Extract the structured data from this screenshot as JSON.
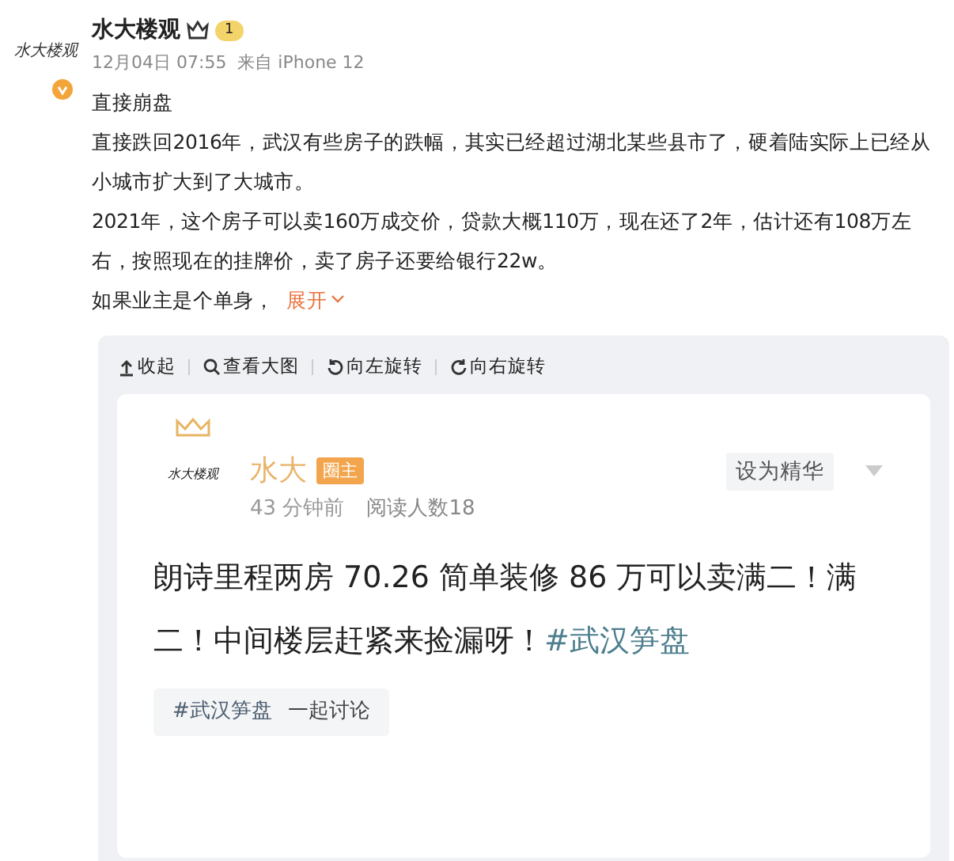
{
  "post": {
    "avatar_text": "水大楼观",
    "verified": true,
    "author": "水大楼观",
    "level": "1",
    "meta": "12月04日 07:55  来自 iPhone 12",
    "title": "直接崩盘",
    "paragraphs": [
      "直接跌回2016年，武汉有些房子的跌幅，其实已经超过湖北某些县市了，硬着陆实际上已经从小城市扩大到了大城市。",
      "2021年，这个房子可以卖160万成交价，贷款大概110万，现在还了2年，估计还有108万左右，按照现在的挂牌价，卖了房子还要给银行22w。"
    ],
    "last_line": "如果业主是个单身，",
    "expand": "展开"
  },
  "image_toolbar": [
    {
      "kind": "collapse",
      "label": "收起"
    },
    {
      "kind": "zoom",
      "label": "查看大图"
    },
    {
      "kind": "rotate_left",
      "label": "向左旋转"
    },
    {
      "kind": "rotate_right",
      "label": "向右旋转"
    }
  ],
  "card": {
    "avatar_text": "水大楼观",
    "name": "水大",
    "role": "圈主",
    "time": "43 分钟前",
    "reads": "阅读人数18",
    "action": "设为精华",
    "text": "朗诗里程两房 70.26 简单装修 86 万可以卖满二！满二！中间楼层赶紧来捡漏呀！",
    "hashtag": "#武汉笋盘",
    "topic_tag": "#武汉笋盘",
    "topic_action": "一起讨论"
  }
}
